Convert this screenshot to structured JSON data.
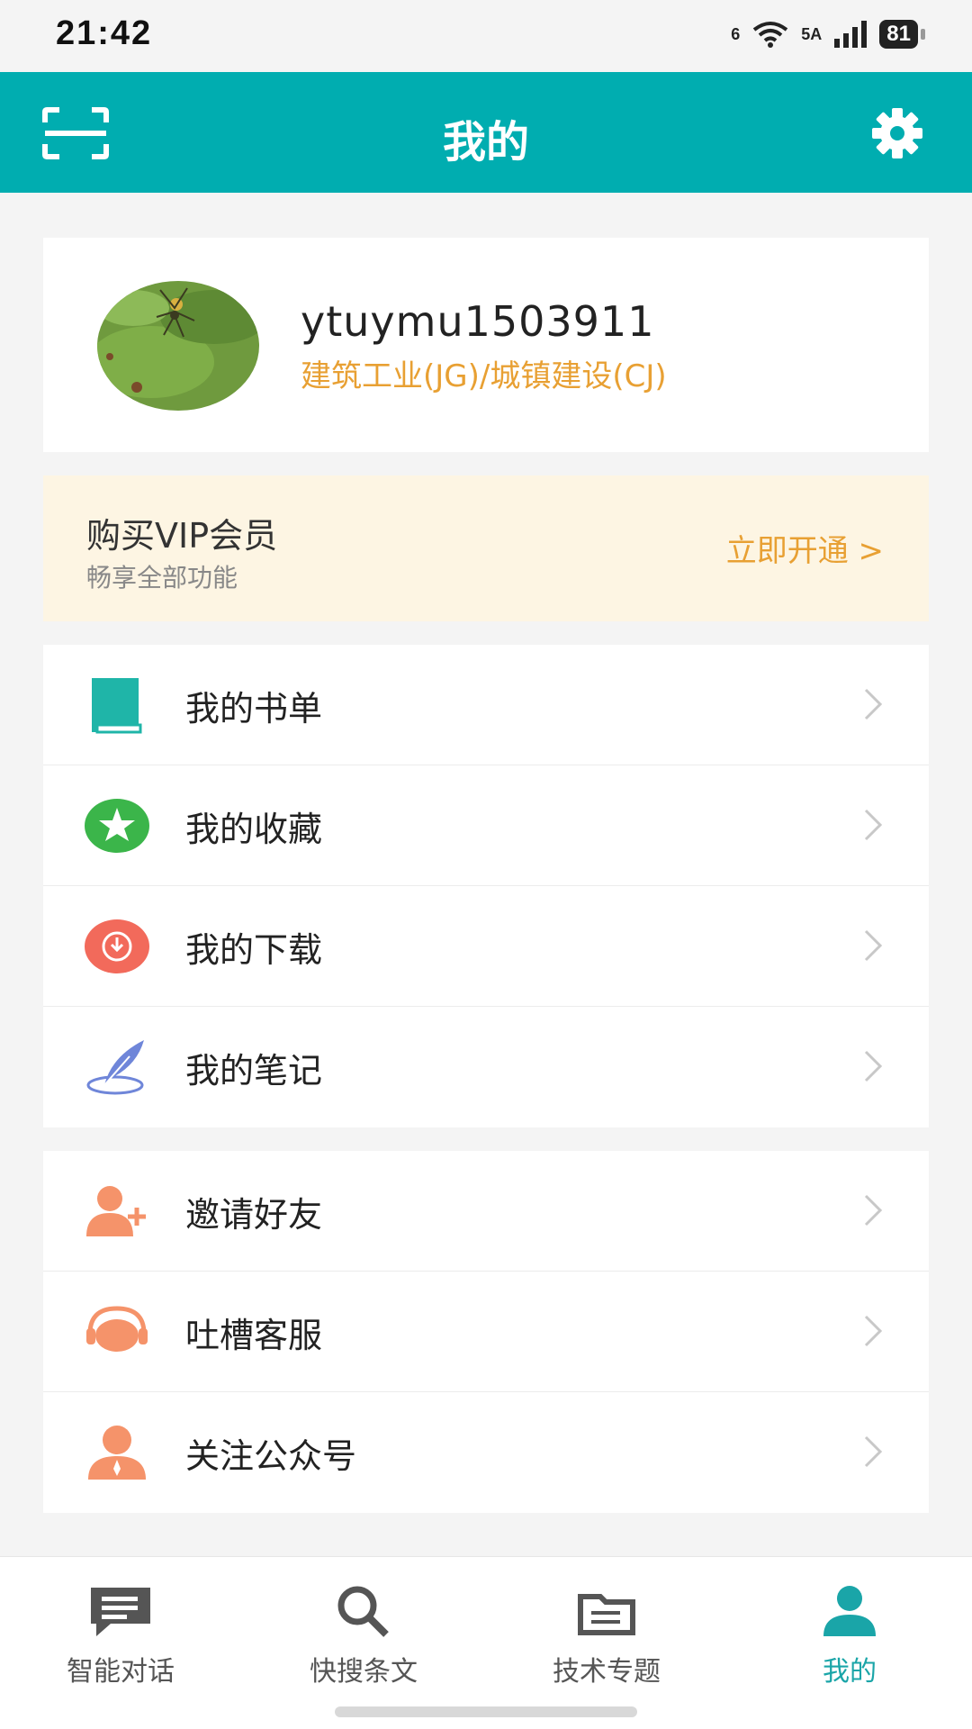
{
  "status_bar": {
    "time": "21:42",
    "wifi_label": "6",
    "signal_label": "5A",
    "battery": "81"
  },
  "header": {
    "title": "我的",
    "scan_icon": "scan-icon",
    "settings_icon": "gear-icon",
    "color": "#00adb0"
  },
  "profile": {
    "username": "ytuymu1503911",
    "organization": "建筑工业(JG)/城镇建设(CJ)"
  },
  "vip": {
    "title": "购买VIP会员",
    "subtitle": "畅享全部功能",
    "cta": "立即开通 >"
  },
  "menu_group_1": [
    {
      "label": "我的书单",
      "icon": "book-icon",
      "color": "#1fb5a8"
    },
    {
      "label": "我的收藏",
      "icon": "star-icon",
      "color": "#3bb54a"
    },
    {
      "label": "我的下载",
      "icon": "download-icon",
      "color": "#f26a5b"
    },
    {
      "label": "我的笔记",
      "icon": "feather-pen-icon",
      "color": "#6f86d9"
    }
  ],
  "menu_group_2": [
    {
      "label": "邀请好友",
      "icon": "add-user-icon",
      "color": "#f5936a"
    },
    {
      "label": "吐槽客服",
      "icon": "headset-icon",
      "color": "#f5936a"
    },
    {
      "label": "关注公众号",
      "icon": "person-tie-icon",
      "color": "#f5936a"
    }
  ],
  "tabbar": [
    {
      "label": "智能对话",
      "icon": "chat-icon",
      "active": false
    },
    {
      "label": "快搜条文",
      "icon": "search-icon",
      "active": false
    },
    {
      "label": "技术专题",
      "icon": "folder-icon",
      "active": false
    },
    {
      "label": "我的",
      "icon": "person-icon",
      "active": true
    }
  ],
  "accent_color": "#1aa5a8",
  "highlight_color": "#e8a033"
}
